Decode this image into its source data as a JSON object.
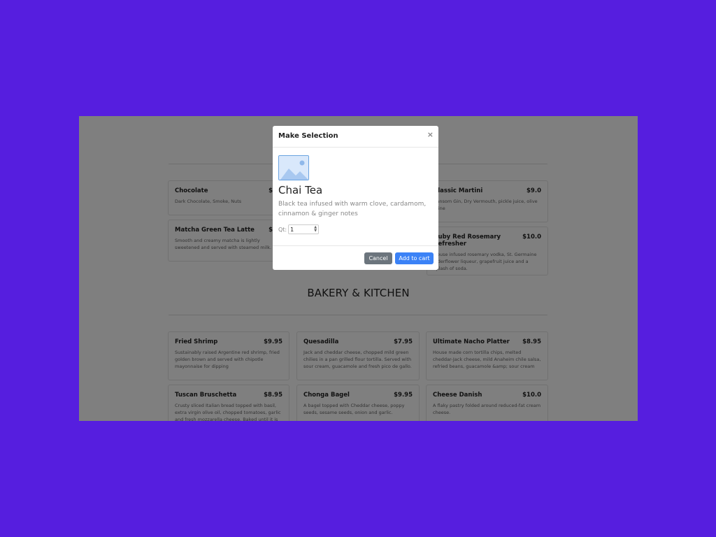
{
  "colors": {
    "background": "#561EDF",
    "overlay": "rgba(0,0,0,0.5)",
    "cancel_button": "#6c757d",
    "primary_button": "#3b82f6"
  },
  "menu": {
    "drinks_left": [
      {
        "name": "Chocolate",
        "price": "$",
        "desc": "Dark Chocolate, Smoke, Nuts"
      },
      {
        "name": "Matcha Green Tea Latte",
        "price": "$",
        "desc": "Smooth and creamy matcha is lightly sweetened and served with steamed milk."
      }
    ],
    "drinks_right": [
      {
        "name": "Classic Martini",
        "price": "$9.0",
        "desc": "Ransom Gin, Dry Vermouth, pickle juice, olive brine"
      },
      {
        "name": "Ruby Red Rosemary Refresher",
        "price": "$10.0",
        "desc": "House infused rosemary vodka, St. Germaine elderflower liqueur, grapefruit juice and a splash of soda."
      }
    ],
    "bakery_section_title": "BAKERY & KITCHEN",
    "bakery_items": [
      {
        "name": "Fried Shrimp",
        "price": "$9.95",
        "desc": "Sustainably raised Argentine red shrimp, fried golden brown and served with chipotle mayonnaise for dipping"
      },
      {
        "name": "Quesadilla",
        "price": "$7.95",
        "desc": "Jack and cheddar cheese, chopped mild green chilies in a pan grilled flour tortilla. Served with sour cream, guacamole and fresh pico de gallo."
      },
      {
        "name": "Ultimate Nacho Platter",
        "price": "$8.95",
        "desc": "House made corn tortilla chips, melted cheddar-Jack cheese, mild Anaheim chile salsa, refried beans, guacamole &amp; sour cream"
      },
      {
        "name": "Tuscan Bruschetta",
        "price": "$8.95",
        "desc": "Crusty sliced Italian bread topped with basil, extra virgin olive oil, chopped tomatoes, garlic and fresh mozzarella cheese. Baked until it is nice and"
      },
      {
        "name": "Chonga Bagel",
        "price": "$9.95",
        "desc": "A bagel topped with Cheddar cheese, poppy seeds, sesame seeds, onion and garlic."
      },
      {
        "name": "Cheese Danish",
        "price": "$10.0",
        "desc": "A flaky pastry folded around reduced-fat cream cheese."
      }
    ]
  },
  "modal": {
    "title": "Make Selection",
    "close_symbol": "×",
    "thumbnail_icon": "image-placeholder-icon",
    "item_name": "Chai Tea",
    "item_desc": "Black tea infused with warm clove, cardamom, cinnamon & ginger notes",
    "qty_label": "Qt:",
    "qty_value": "1",
    "cancel_label": "Cancel",
    "add_label": "Add to cart"
  }
}
